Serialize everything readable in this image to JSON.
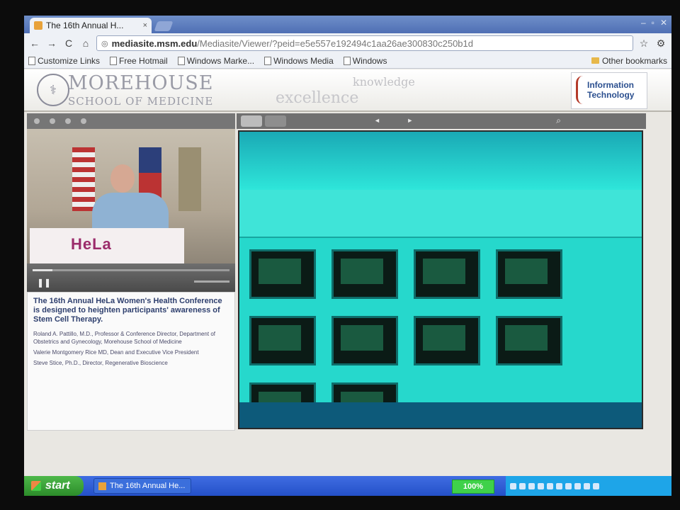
{
  "browser": {
    "tab_title": "The 16th Annual H...",
    "tab_close": "×",
    "url_host": "mediasite.msm.edu",
    "url_path": "/Mediasite/Viewer/?peid=e5e557e192494c1aa26ae300830c250b1d",
    "bookmarks": [
      "Customize Links",
      "Free Hotmail",
      "Windows Marke...",
      "Windows Media",
      "Windows"
    ],
    "other_bookmarks": "Other bookmarks",
    "nav_icons": {
      "back": "←",
      "forward": "→",
      "reload": "C",
      "home": "⌂",
      "star": "☆",
      "wrench": "⚙"
    }
  },
  "banner": {
    "school_line1": "MOREHOUSE",
    "school_line2": "SCHOOL OF MEDICINE",
    "motto_small": "knowledge",
    "motto_large": "excellence",
    "it_logo": [
      "Information",
      "Technology"
    ]
  },
  "player": {
    "podium_text": "HeLa",
    "description": "The 16th Annual HeLa Women's Health Conference is designed to heighten participants' awareness of Stem Cell Therapy.",
    "presenters": [
      "Roland A. Pattillo, M.D., Professor & Conference Director, Department of Obstetrics and Gynecology, Morehouse School of Medicine",
      "Valerie Montgomery Rice MD, Dean and Executive Vice President",
      "Steve Stice, Ph.D., Director, Regenerative Bioscience"
    ],
    "playback_position": 0.1
  },
  "taskbar": {
    "start_label": "start",
    "task_title": "The 16th Annual He...",
    "zoom": "100%"
  },
  "colors": {
    "slide_bg": "#1fd4c8",
    "taskbar": "#2450c8",
    "start": "#3aa83a"
  }
}
